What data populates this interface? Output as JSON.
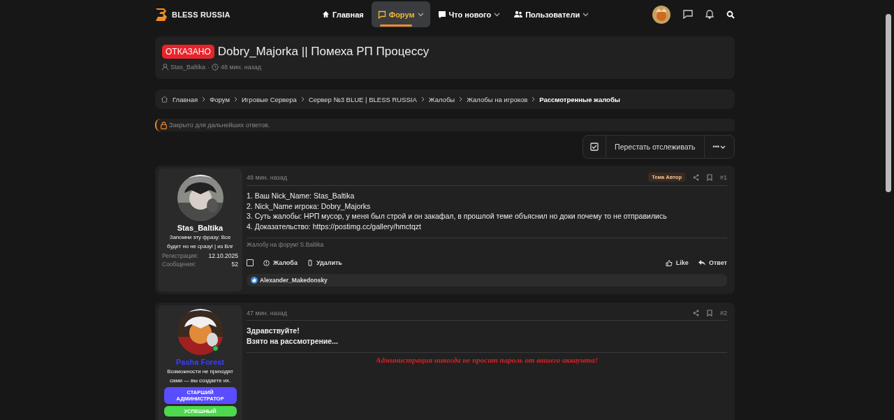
{
  "header": {
    "logo": "BLESS RUSSIA",
    "nav": [
      {
        "label": "Главная",
        "selected": false,
        "dropdown": false
      },
      {
        "label": "Форум",
        "selected": true,
        "dropdown": true
      },
      {
        "label": "Что нового",
        "selected": false,
        "dropdown": true
      },
      {
        "label": "Пользователи",
        "selected": false,
        "dropdown": true
      }
    ]
  },
  "thread": {
    "status": "ОТКАЗАНО",
    "title": "Dobry_Majorka || Помеха РП Процессу",
    "author": "Stas_Baltika",
    "separator": "·",
    "time": "48 мин. назад"
  },
  "breadcrumbs": [
    {
      "label": "Главная",
      "current": false
    },
    {
      "label": "Форум",
      "current": false
    },
    {
      "label": "Игровые Сервера",
      "current": false
    },
    {
      "label": "Сервер №3 BLUE | BLESS RUSSIA",
      "current": false
    },
    {
      "label": "Жалобы",
      "current": false
    },
    {
      "label": "Жалобы на игроков",
      "current": false
    },
    {
      "label": "Рассмотренные жалобы",
      "current": true
    }
  ],
  "locked_notice": "Закрыто для дальнейших ответов.",
  "watch": {
    "checked": true,
    "label": "Перестать отслеживать",
    "more": "•••"
  },
  "posts": [
    {
      "author": "Stas_Baltika",
      "color": "#ffffff",
      "online": false,
      "status": "Запомни эту фразу: Все будет но не сразу! | из Влг",
      "stats": [
        {
          "label": "Регистрация:",
          "value": "12.10.2025"
        },
        {
          "label": "Сообщения:",
          "value": "52"
        }
      ],
      "time": "48 мин. назад",
      "tag": "Тема Автор",
      "number": "#1",
      "lines": [
        "1. Ваш Nick_Name: Stas_Baltika",
        "2. Nick_Name игрока: Dobry_Majorks",
        "3. Суть жалобы: НРП мусор, у меня был строй и он закафал, в прошлой теме объяснил но доки почему то не отправились",
        "4. Доказательство: https://postimg.cc/gallery/hmctqzt"
      ],
      "signature": {
        "kind": "plain",
        "text": "Жалобу на форум! S.Baltika"
      },
      "actions": {
        "selected": false,
        "left": [
          "Жалоба",
          "Удалить"
        ],
        "like": "Like",
        "reply": "Ответ"
      },
      "reactions": "Alexander_Makedonsky"
    },
    {
      "author": "Pasha Forest",
      "color": "#3d3dff",
      "online": true,
      "status": "Возможности не приходят сами — вы создаете их.",
      "badges": [
        {
          "label": "СТАРШИЙ АДМИНИСТРАТОР",
          "color": "#5a4dff"
        },
        {
          "label": "УСПЕШНЫЙ",
          "color": "#4cd94c"
        }
      ],
      "time": "47 мин. назад",
      "number": "#2",
      "lines": [
        "Здравствуйте!",
        "Взято на рассмотрение..."
      ],
      "signature": {
        "kind": "warning",
        "text": "Администрация никогда не просит пароль от вашего аккаунта!"
      }
    }
  ]
}
